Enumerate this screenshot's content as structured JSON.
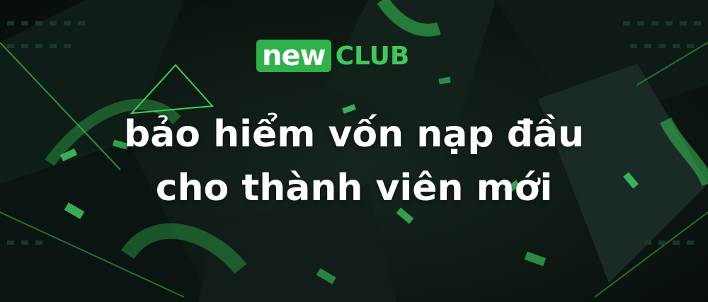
{
  "logo": {
    "badge_text": "new",
    "name_text": "CLUB"
  },
  "headline": {
    "line1": "Bảo Hiểm vốn nạp đầu",
    "line2": "CHO THành viên mới"
  },
  "colors": {
    "brand_green": "#2fb24a",
    "background": "#0d1813",
    "text": "#ffffff"
  }
}
